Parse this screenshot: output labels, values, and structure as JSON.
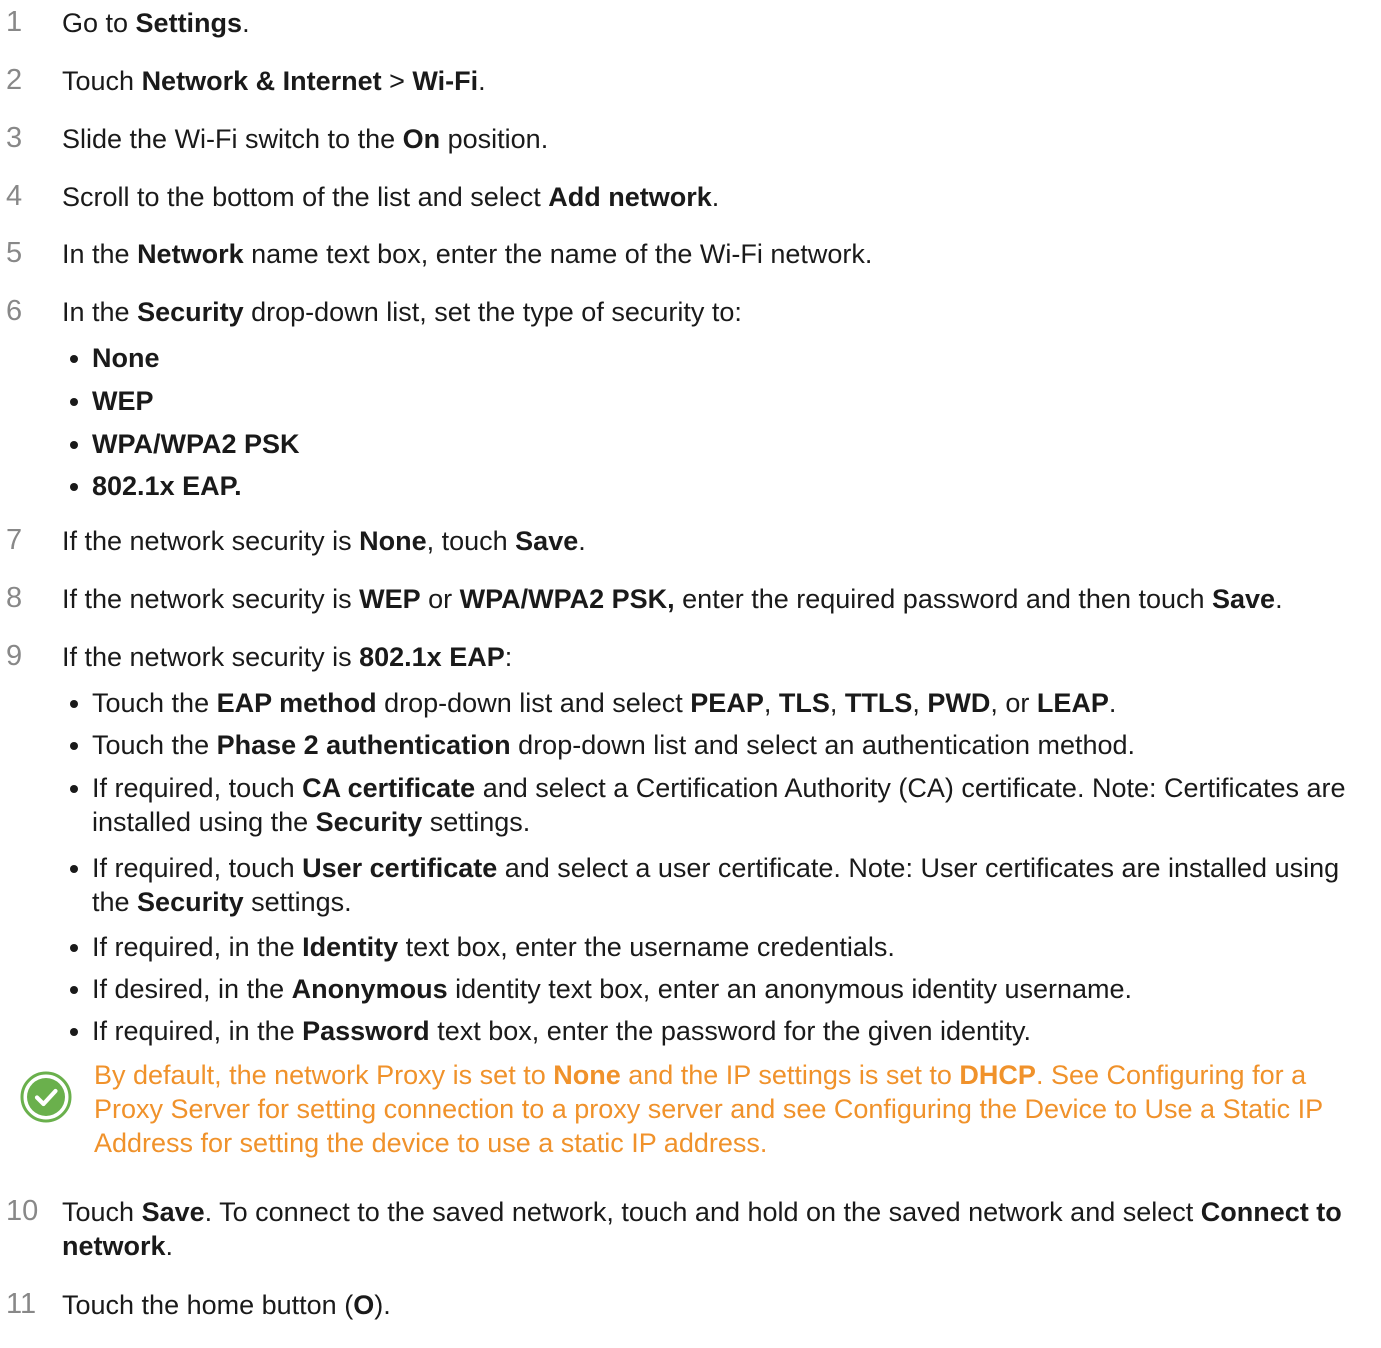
{
  "steps": [
    {
      "num": "1",
      "parts": [
        "Go to ",
        "Settings",
        "."
      ]
    },
    {
      "num": "2",
      "parts": [
        "Touch ",
        "Network & Internet",
        " > ",
        "Wi-Fi",
        "."
      ]
    },
    {
      "num": "3",
      "parts": [
        "Slide the Wi-Fi switch to the ",
        "On",
        " position."
      ]
    },
    {
      "num": "4",
      "parts": [
        "Scroll to the bottom of the list and select ",
        "Add network",
        "."
      ]
    },
    {
      "num": "5",
      "parts": [
        "In the ",
        "Network",
        " name text box, enter the name of the Wi-Fi network."
      ]
    },
    {
      "num": "6",
      "parts": [
        "In the ",
        "Security",
        " drop-down list, set the type of security to:"
      ]
    },
    {
      "num": "7",
      "parts": [
        "If the network security is ",
        "None",
        ", touch ",
        "Save",
        "."
      ]
    },
    {
      "num": "8",
      "parts": [
        "If the network security is ",
        "WEP",
        " or ",
        "WPA/WPA2 PSK,",
        " enter the required password and then touch ",
        "Save",
        "."
      ]
    },
    {
      "num": "9",
      "parts": [
        "If the network security is ",
        "802.1x EAP",
        ":"
      ]
    },
    {
      "num": "10",
      "parts": [
        "Touch ",
        "Save",
        ". To connect to the saved network, touch and hold on the saved network and select ",
        "Connect to network",
        "."
      ]
    },
    {
      "num": "11",
      "parts": [
        "Touch the home button (",
        "O",
        ")."
      ]
    }
  ],
  "security_options": [
    "None",
    "WEP",
    "WPA/WPA2 PSK",
    "802.1x EAP."
  ],
  "eap_bullets": [
    {
      "parts": [
        "Touch the ",
        "EAP method",
        " drop-down list and select ",
        "PEAP",
        ", ",
        "TLS",
        ", ",
        "TTLS",
        ", ",
        "PWD",
        ", or ",
        "LEAP",
        "."
      ]
    },
    {
      "parts": [
        "Touch the ",
        "Phase 2 authentication",
        " drop-down list and select an authentication method."
      ]
    },
    {
      "parts": [
        "If required, touch ",
        "CA certificate",
        " and select a Certification Authority (CA) certificate. Note: Certificates are installed using the ",
        "Security",
        " settings."
      ]
    },
    {
      "parts": [
        "If required, touch ",
        "User certificate",
        " and select a user certificate. Note: User certificates are installed using the ",
        "Security",
        " settings."
      ]
    },
    {
      "parts": [
        "If required, in the ",
        "Identity",
        " text box, enter the username credentials."
      ]
    },
    {
      "parts": [
        "If desired, in the ",
        "Anonymous",
        " identity text box, enter an anonymous identity username."
      ]
    },
    {
      "parts": [
        "If required, in the ",
        "Password",
        " text box, enter the password for the given identity."
      ]
    }
  ],
  "note": {
    "parts": [
      "By default, the network Proxy is set to ",
      "None",
      " and the IP settings is set to ",
      "DHCP",
      ". See Configuring for a Proxy Server for setting connection to a proxy server and see Configuring the Device to Use a Static IP Address for setting the device to use a static IP address."
    ],
    "icon": "check-circle-icon",
    "color": "#f0922b",
    "icon_color": "#6ab04c"
  }
}
